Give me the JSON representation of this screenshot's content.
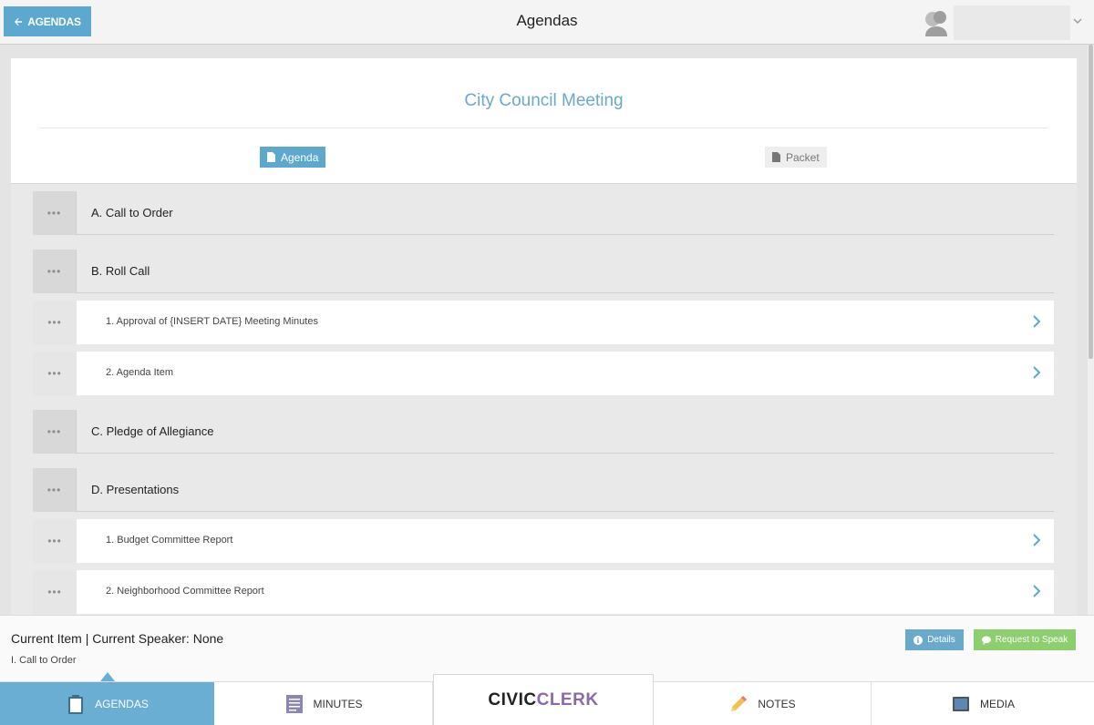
{
  "header": {
    "back_label": "AGENDAS",
    "title": "Agendas"
  },
  "meeting": {
    "title": "City Council Meeting",
    "agenda_button": "Agenda",
    "packet_button": "Packet"
  },
  "agenda": {
    "rows": [
      {
        "type": "section",
        "label": "A. Call to Order"
      },
      {
        "type": "section",
        "label": "B. Roll Call"
      },
      {
        "type": "item",
        "label": "1. Approval of {INSERT DATE} Meeting Minutes"
      },
      {
        "type": "item",
        "label": "2. Agenda Item"
      },
      {
        "type": "section",
        "label": "C. Pledge of Allegiance"
      },
      {
        "type": "section",
        "label": "D. Presentations"
      },
      {
        "type": "item",
        "label": "1. Budget Committee Report"
      },
      {
        "type": "item",
        "label": "2. Neighborhood Committee Report"
      }
    ]
  },
  "current": {
    "line": "Current Item | Current Speaker: None",
    "item": "I. Call to Order",
    "details_button": "Details",
    "speak_button": "Request to Speak"
  },
  "nav": {
    "agendas": "AGENDAS",
    "minutes": "MINUTES",
    "brand_civic": "CIVIC",
    "brand_clerk": "CLERK",
    "notes": "NOTES",
    "media": "MEDIA"
  },
  "colors": {
    "accent": "#5da8cf",
    "speak_green": "#8dcf6f",
    "brand_purple": "#8b6aa8"
  }
}
